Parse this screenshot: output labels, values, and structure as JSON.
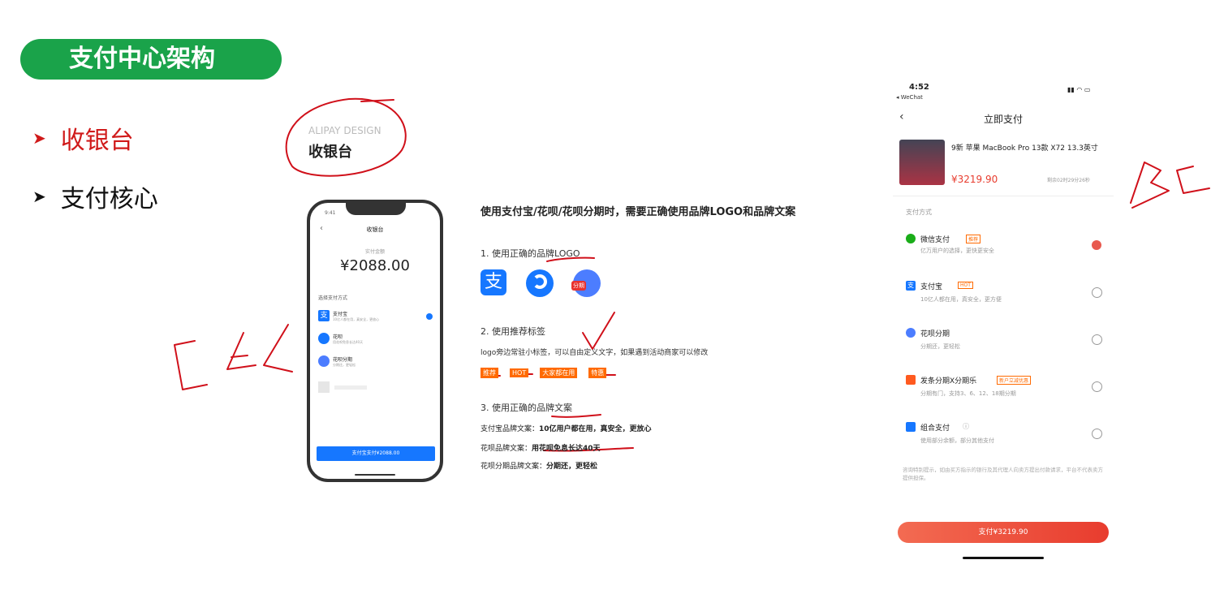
{
  "slide": {
    "title": "支付中心架构",
    "bullets": [
      {
        "label": "收银台",
        "color": "#d01a1a"
      },
      {
        "label": "支付核心",
        "color": "#111111"
      }
    ]
  },
  "brand_card": {
    "subtitle": "ALIPAY DESIGN",
    "title": "收银台"
  },
  "phone_mock": {
    "status": "9:41",
    "nav_title": "收银台",
    "amount_label": "实付金额",
    "amount": "¥2088.00",
    "section_label": "选择支付方式",
    "methods": [
      {
        "name": "支付宝",
        "desc": "10亿人都在用，真安全，更放心"
      },
      {
        "name": "花呗",
        "desc": "用花呗免息长达40天"
      },
      {
        "name": "花呗分期",
        "desc": "分期还，更轻松"
      }
    ],
    "button": "支付宝支付¥2088.00"
  },
  "guidelines": {
    "heading": "使用支付宝/花呗/花呗分期时，需要正确使用品牌LOGO和品牌文案",
    "step1": "1. 使用正确的品牌LOGO",
    "logo_badge": "分期",
    "step2": "2. 使用推荐标签",
    "step2_desc": "logo旁边常驻小标签，可以自由定义文字，如果遇到活动商家可以修改",
    "tags": [
      "推荐",
      "HOT",
      "大家都在用",
      "特惠"
    ],
    "step3": "3. 使用正确的品牌文案",
    "copy": [
      {
        "label": "支付宝品牌文案：",
        "text": "10亿用户都在用，真安全，更放心"
      },
      {
        "label": "花呗品牌文案：",
        "text": "用花呗免息长达40天"
      },
      {
        "label": "花呗分期品牌文案：",
        "text": "分期还，更轻松"
      }
    ]
  },
  "checkout_app": {
    "time": "4:52",
    "back_app": "◂ WeChat",
    "title": "立即支付",
    "product": "9新 苹果 MacBook Pro 13款 X72 13.3英寸",
    "price": "¥3219.90",
    "countdown": "剩余02时29分26秒",
    "section": "支付方式",
    "methods": [
      {
        "name": "微信支付",
        "desc": "亿万用户的选择，更快更安全",
        "tag": "推荐",
        "selected": true,
        "color": "#1aad19"
      },
      {
        "name": "支付宝",
        "desc": "10亿人都在用，真安全，更方便",
        "tag": "HOT",
        "selected": false,
        "color": "#1677ff"
      },
      {
        "name": "花呗分期",
        "desc": "分期还，更轻松",
        "tag": "",
        "selected": false,
        "color": "#1677ff"
      },
      {
        "name": "发条分期X分期乐",
        "desc": "分期有门，支持3、6、12、18期分期",
        "tag": "新户立减优惠",
        "selected": false,
        "color": "#ff5a1f"
      },
      {
        "name": "组合支付",
        "desc": "使用部分余额，部分其他支付",
        "tag": "",
        "selected": false,
        "color": "#1677ff"
      }
    ],
    "disclaimer": "咨询特别提示，如由买方指示的银行及其代理人向卖方提出付款请求，平台不代表卖方提供担保。",
    "pay_button": "支付¥3219.90"
  },
  "annotations": {
    "left": "CAC",
    "right": "BC"
  }
}
